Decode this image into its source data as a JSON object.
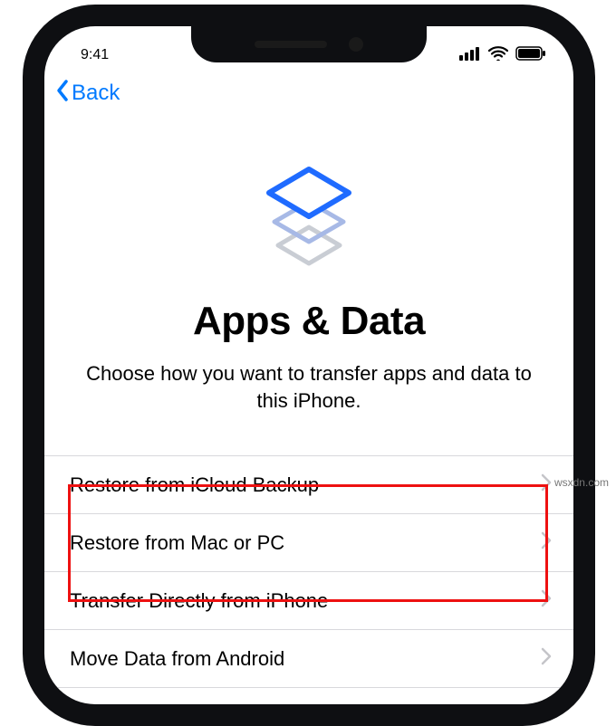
{
  "status": {
    "time": "9:41"
  },
  "nav": {
    "back_label": "Back"
  },
  "page": {
    "title": "Apps & Data",
    "subtitle": "Choose how you want to transfer apps and data to this iPhone."
  },
  "options": [
    {
      "label": "Restore from iCloud Backup"
    },
    {
      "label": "Restore from Mac or PC"
    },
    {
      "label": "Transfer Directly from iPhone"
    },
    {
      "label": "Move Data from Android"
    }
  ],
  "watermark": "wsxdn.com"
}
